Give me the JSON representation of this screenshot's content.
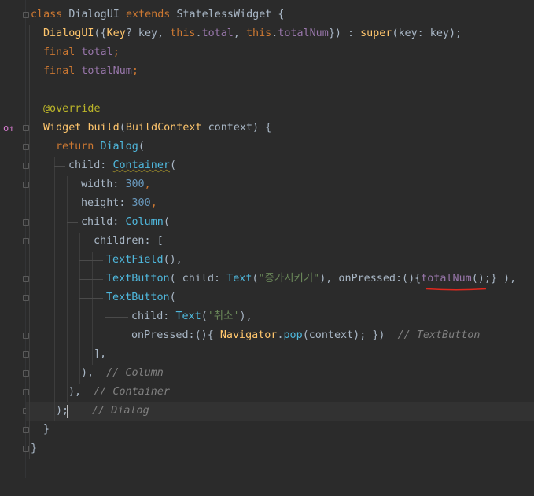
{
  "editor": {
    "lines": {
      "l1": {
        "class_kw": "class",
        "name": "DialogUI",
        "extends_kw": "extends",
        "base": "StatelessWidget",
        "brace": " {"
      },
      "l2": {
        "ctor": "DialogUI",
        "p1": "({",
        "key_type": "Key",
        "p2": "? key, ",
        "this1": "this",
        "dot1": ".",
        "total": "total",
        "p3": ", ",
        "this2": "this",
        "dot2": ".",
        "totalNum": "totalNum",
        "p4": "}) : ",
        "super_kw": "super",
        "p5": "(key: key);"
      },
      "l3": {
        "final_kw": "final",
        "field": "total",
        "semi": ";"
      },
      "l4": {
        "final_kw": "final",
        "field": "totalNum",
        "semi": ";"
      },
      "l6": {
        "annotation": "@override"
      },
      "l7": {
        "type": "Widget",
        "fn": "build",
        "p1": "(",
        "ctx_type": "BuildContext",
        "p2": " context) {"
      },
      "l8": {
        "return_kw": "return",
        "dialog": "Dialog",
        "p1": "("
      },
      "l9": {
        "child": "child: ",
        "container": "Container",
        "p1": "("
      },
      "l10": {
        "width": "width: ",
        "value": "300",
        "comma": ","
      },
      "l11": {
        "height": "height: ",
        "value": "300",
        "comma": ","
      },
      "l12": {
        "child": "child: ",
        "column": "Column",
        "p1": "("
      },
      "l13": {
        "children": "children: ["
      },
      "l14": {
        "textfield": "TextField",
        "rest": "(),"
      },
      "l15": {
        "textbutton": "TextButton",
        "p1": "( child: ",
        "text": "Text",
        "p2": "(",
        "str": "\"증가시키기\"",
        "p3": "), onPressed:(){",
        "call": "totalNum",
        "p4": "();} ),"
      },
      "l16": {
        "textbutton": "TextButton",
        "p1": "("
      },
      "l17": {
        "child": "child: ",
        "text": "Text",
        "p1": "(",
        "str": "'취소'",
        "p2": "),"
      },
      "l18": {
        "onpressed": "onPressed:(){ ",
        "navigator": "Navigator",
        "dot": ".",
        "pop": "pop",
        "p1": "(context); })  ",
        "comment": "// TextButton"
      },
      "l19": {
        "text": "],"
      },
      "l20": {
        "text": "),  ",
        "comment": "// Column"
      },
      "l21": {
        "text": "),  ",
        "comment": "// Container"
      },
      "l22": {
        "text": ");",
        "comment": "// Dialog"
      },
      "l23": {
        "text": "}"
      },
      "l24": {
        "text": "}"
      }
    },
    "gutter_icon": "override-method-icon",
    "gutter_icon_glyph": "o↑"
  }
}
